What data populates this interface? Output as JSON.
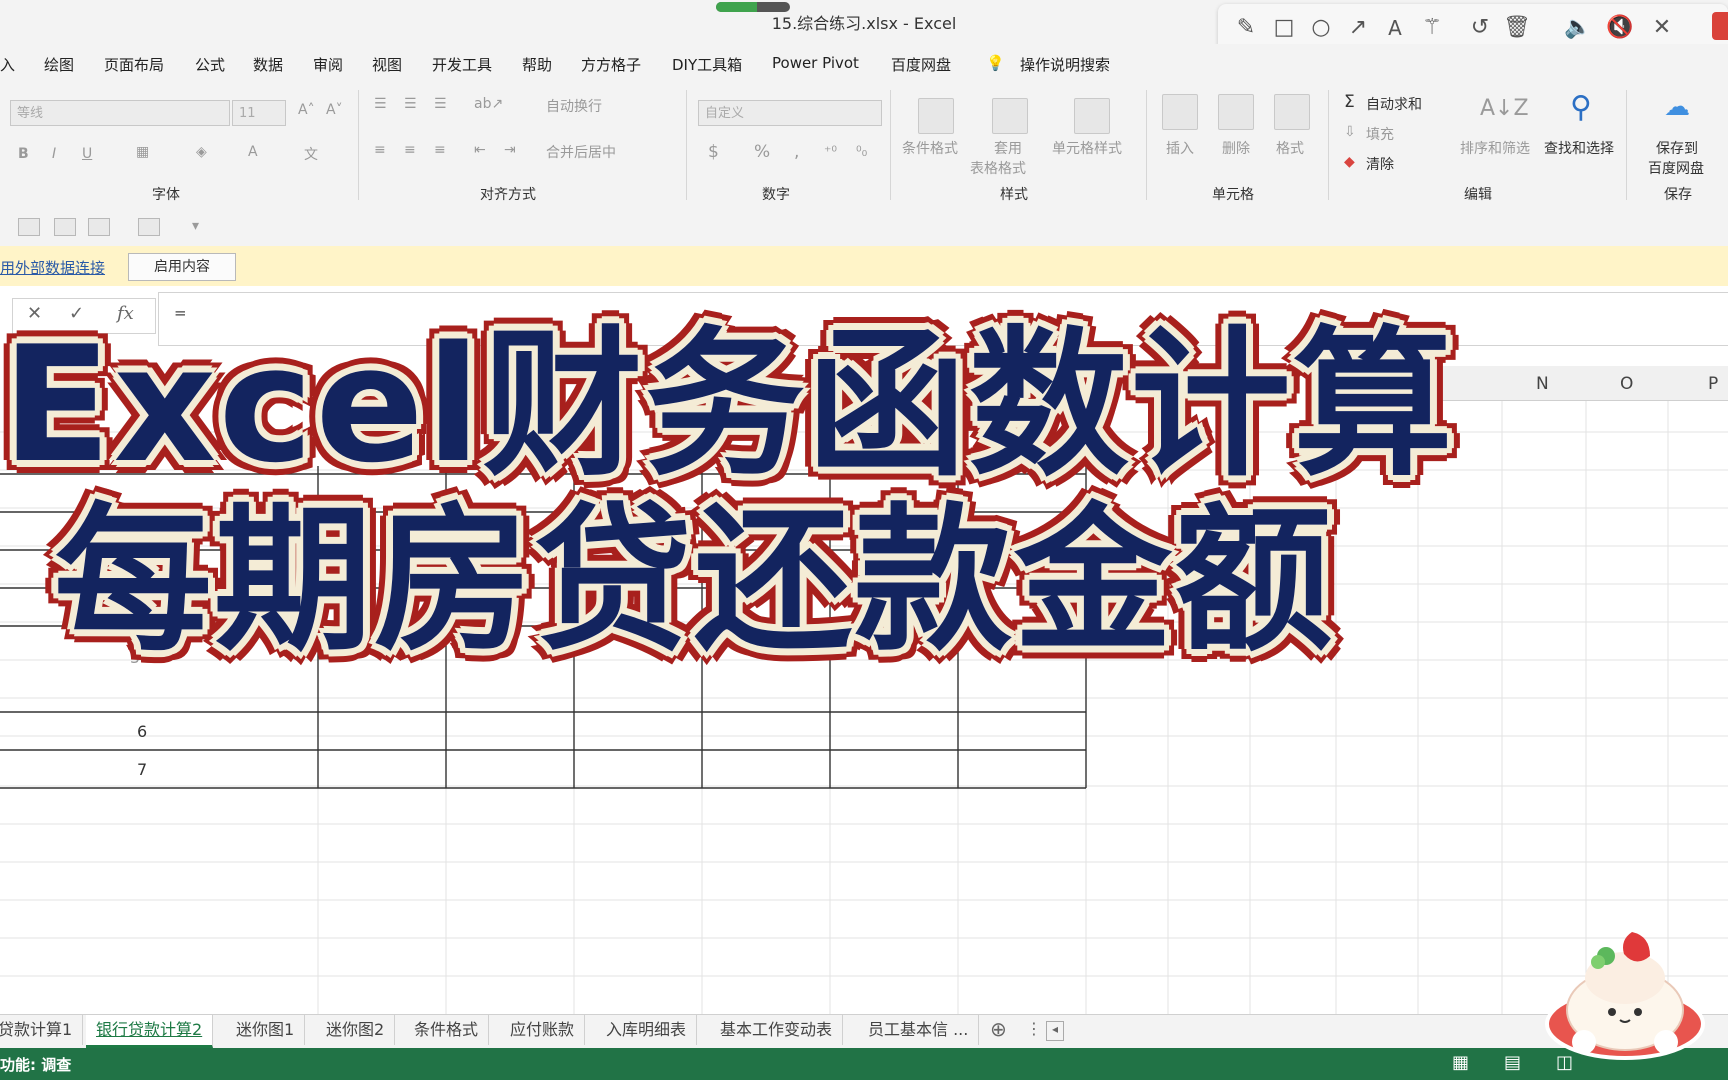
{
  "window": {
    "title": "15.综合练习.xlsx  -  Excel",
    "load_progress": 0.55
  },
  "annotation_toolbar": {
    "icons": [
      "pencil-icon",
      "rectangle-icon",
      "circle-icon",
      "arrow-icon",
      "text-icon",
      "magic-wand-icon",
      "undo-icon",
      "trash-icon",
      "speaker-icon",
      "mute-icon",
      "close-icon"
    ]
  },
  "menu": [
    "插入",
    "绘图",
    "页面布局",
    "公式",
    "数据",
    "审阅",
    "视图",
    "开发工具",
    "帮助",
    "方方格子",
    "DIY工具箱",
    "Power Pivot",
    "百度网盘",
    "操作说明搜索"
  ],
  "menu_visible": [
    "入",
    "绘图",
    "页面布局",
    "公式",
    "数据",
    "审阅",
    "视图",
    "开发工具",
    "帮助",
    "方方格子",
    "DIY工具箱",
    "Power Pivot",
    "百度网盘",
    "操作说明搜索"
  ],
  "ribbon": {
    "font": {
      "name": "等线",
      "size": "11",
      "group_label": "字体"
    },
    "align": {
      "wrap": "自动换行",
      "merge": "合并后居中",
      "group_label": "对齐方式"
    },
    "number": {
      "format": "自定义",
      "group_label": "数字",
      "symbols": [
        "$",
        "%",
        ","
      ]
    },
    "styles": {
      "conditional": "条件格式",
      "table1": "套用",
      "table2": "表格格式",
      "cell_styles": "单元格样式",
      "group_label": "样式"
    },
    "cells": {
      "insert": "插入",
      "delete": "删除",
      "format": "格式",
      "group_label": "单元格"
    },
    "editing": {
      "autosum": "自动求和",
      "fill": "填充",
      "clear": "清除",
      "sort": "排序和筛选",
      "find": "查找和选择",
      "group_label": "编辑"
    },
    "save": {
      "line1": "保存到",
      "line2": "百度网盘",
      "group_label": "保存"
    }
  },
  "message_bar": {
    "link": "用外部数据连接",
    "button": "启用内容"
  },
  "formula_bar": {
    "value": "="
  },
  "columns": [
    "N",
    "O",
    "P"
  ],
  "row_numbers": [
    "5",
    "6",
    "7"
  ],
  "overlay": {
    "line1": "Excel财务函数计算",
    "line2": "每期房贷还款金额"
  },
  "sheet_tabs": [
    "贷款计算1",
    "银行贷款计算2",
    "迷你图1",
    "迷你图2",
    "条件格式",
    "应付账款",
    "入库明细表",
    "基本工作变动表",
    "员工基本信 ..."
  ],
  "active_tab_index": 1,
  "status": {
    "text": "功能: 调查"
  },
  "colors": {
    "excel_green": "#217346",
    "title_navy": "#13245f",
    "outline_red": "#a8201d",
    "outline_cream": "#f4ecd6"
  }
}
